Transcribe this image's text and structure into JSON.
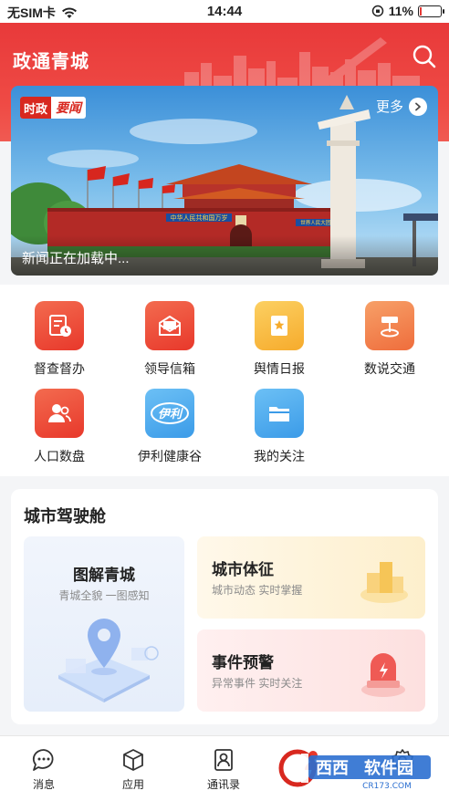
{
  "status": {
    "carrier": "无SIM卡",
    "time": "14:44",
    "battery": "11%",
    "battery_level": 0.11
  },
  "header": {
    "title": "政通青城"
  },
  "banner": {
    "tag_left": "时政",
    "tag_right": "要闻",
    "more_label": "更多",
    "caption": "新闻正在加载中...",
    "gate_sign": "中华人民共和国万岁",
    "gate_sign_right": "世界人民大团结万岁"
  },
  "apps": [
    {
      "label": "督查督办",
      "icon": "supervision-icon",
      "color": "#ef4a3a"
    },
    {
      "label": "领导信箱",
      "icon": "mailbox-icon",
      "color": "#ef4a3a"
    },
    {
      "label": "舆情日报",
      "icon": "daily-report-icon",
      "color": "#f8b737"
    },
    {
      "label": "数说交通",
      "icon": "traffic-icon",
      "color": "#f07a45"
    },
    {
      "label": "人口数盘",
      "icon": "population-icon",
      "color": "#ef4a3a"
    },
    {
      "label": "伊利健康谷",
      "icon": "yili-logo-icon",
      "logo_text": "伊利",
      "color": "#3b9be8"
    },
    {
      "label": "我的关注",
      "icon": "folder-icon",
      "color": "#3b9be8"
    }
  ],
  "cockpit": {
    "title": "城市驾驶舱",
    "cards": [
      {
        "title": "图解青城",
        "subtitle": "青城全貌 一图感知"
      },
      {
        "title": "城市体征",
        "subtitle": "城市动态 实时掌握"
      },
      {
        "title": "事件预警",
        "subtitle": "异常事件 实时关注"
      }
    ]
  },
  "tabbar": [
    {
      "label": "消息",
      "icon": "message-icon"
    },
    {
      "label": "应用",
      "icon": "apps-cube-icon"
    },
    {
      "label": "通讯录",
      "icon": "contacts-icon"
    },
    {
      "label": "",
      "icon": "profile-icon"
    },
    {
      "label": "",
      "icon": "settings-icon"
    }
  ],
  "watermark": {
    "brand": "西西",
    "brand2": "软件园",
    "url": "CR173.COM"
  }
}
